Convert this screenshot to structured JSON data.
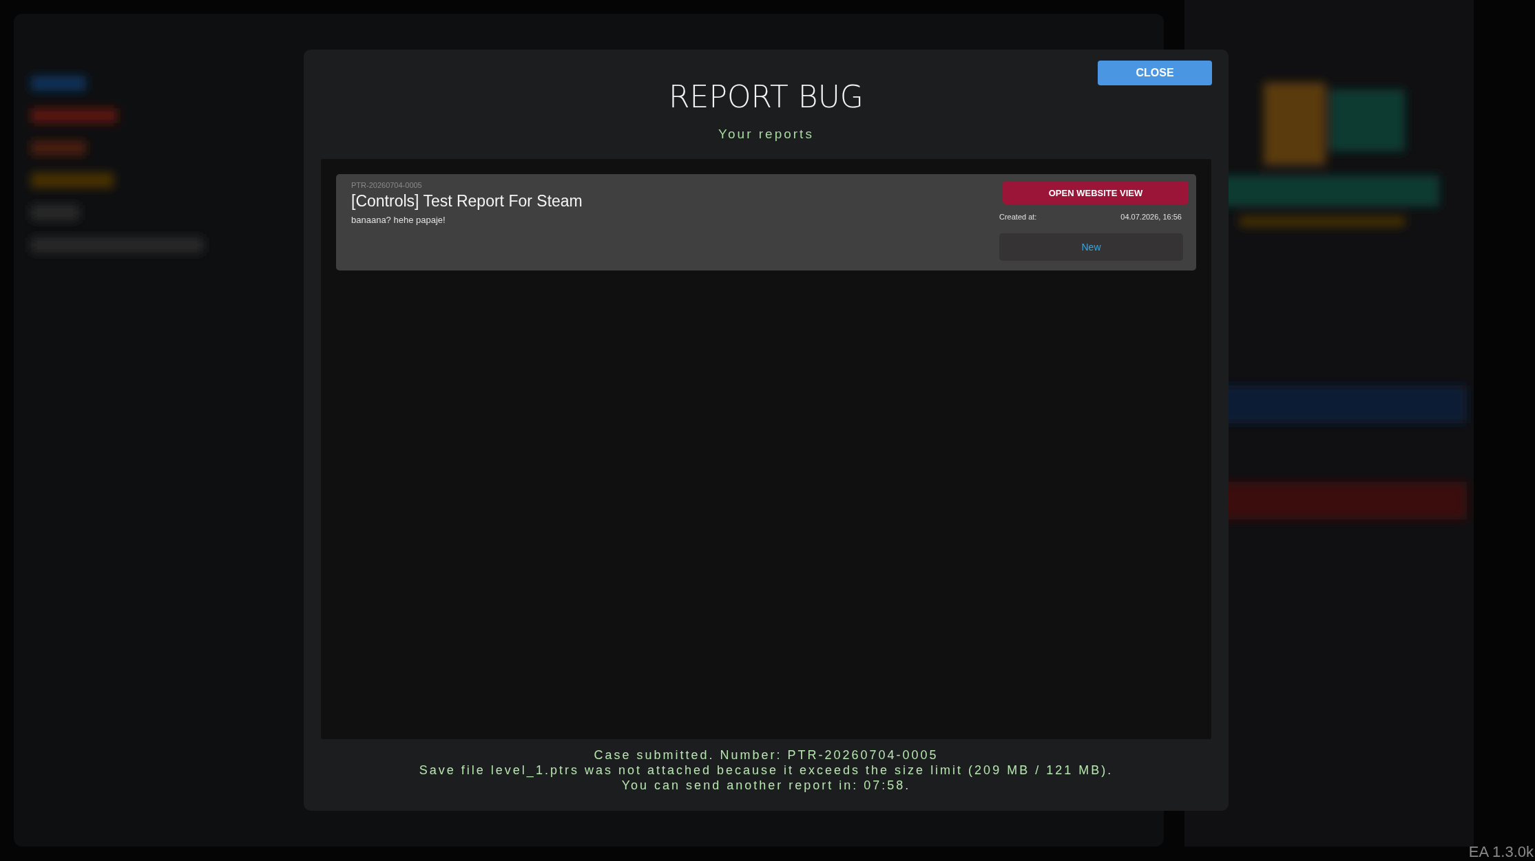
{
  "dialog": {
    "title": "REPORT BUG",
    "subtitle": "Your reports",
    "close_button": "CLOSE",
    "reports": [
      {
        "number": "PTR-20260704-0005",
        "title": "[Controls] Test Report For Steam",
        "description": "banaana? hehe papaje!",
        "open_button": "OPEN WEBSITE VIEW",
        "created_label": "Created at:",
        "created_value": "04.07.2026, 16:56",
        "status": "New"
      }
    ],
    "messages": [
      "Case submitted. Number: PTR-20260704-0005",
      "Save file level_1.ptrs was not attached because it exceeds the size limit (209 MB / 121 MB).",
      "You can send another report in: 07:58."
    ]
  },
  "version": "EA 1.3.0k"
}
